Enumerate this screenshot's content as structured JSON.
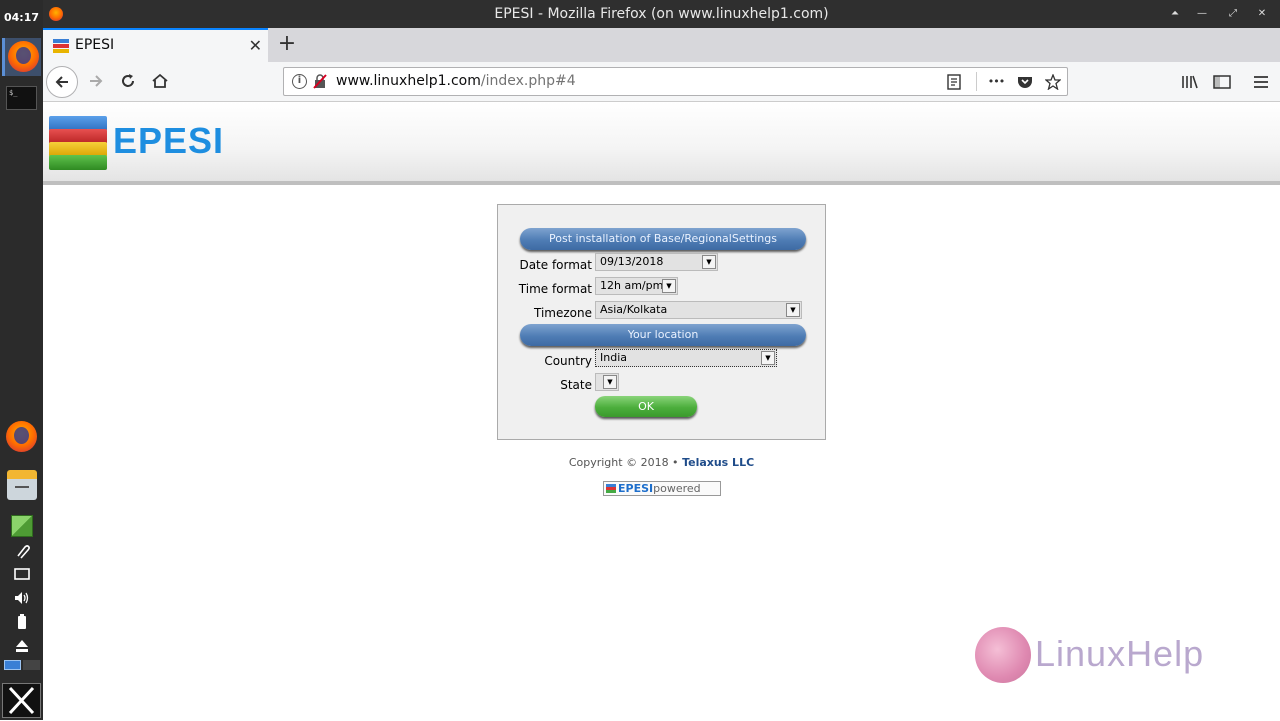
{
  "dock": {
    "clock": "04:17",
    "terminal_text": "$_"
  },
  "window": {
    "title": "EPESI - Mozilla Firefox (on www.linuxhelp1.com)"
  },
  "tab": {
    "label": "EPESI",
    "close": "✕",
    "new_tab": "+"
  },
  "nav": {
    "url_host": "www.linuxhelp1.com",
    "url_path": "/index.php#4",
    "more": "•••"
  },
  "header": {
    "logo_text": "EPESI"
  },
  "form": {
    "section1_title": "Post installation of Base/RegionalSettings",
    "date_format_label": "Date format",
    "date_format_value": "09/13/2018",
    "time_format_label": "Time format",
    "time_format_value": "12h am/pm",
    "timezone_label": "Timezone",
    "timezone_value": "Asia/Kolkata",
    "section2_title": "Your location",
    "country_label": "Country",
    "country_value": "India",
    "state_label": "State",
    "state_value": "",
    "ok_label": "OK"
  },
  "footer": {
    "copyright_prefix": "Copyright © 2018 •",
    "company": "Telaxus LLC",
    "powered_brand": "EPESI",
    "powered_word": "powered"
  },
  "watermark": {
    "text": "LinuxHelp"
  },
  "colors": {
    "section_bar": "#4f7db5",
    "ok_button": "#4cae3c",
    "logo_blue": "#1e8ee0",
    "tab_accent": "#0a84ff"
  }
}
